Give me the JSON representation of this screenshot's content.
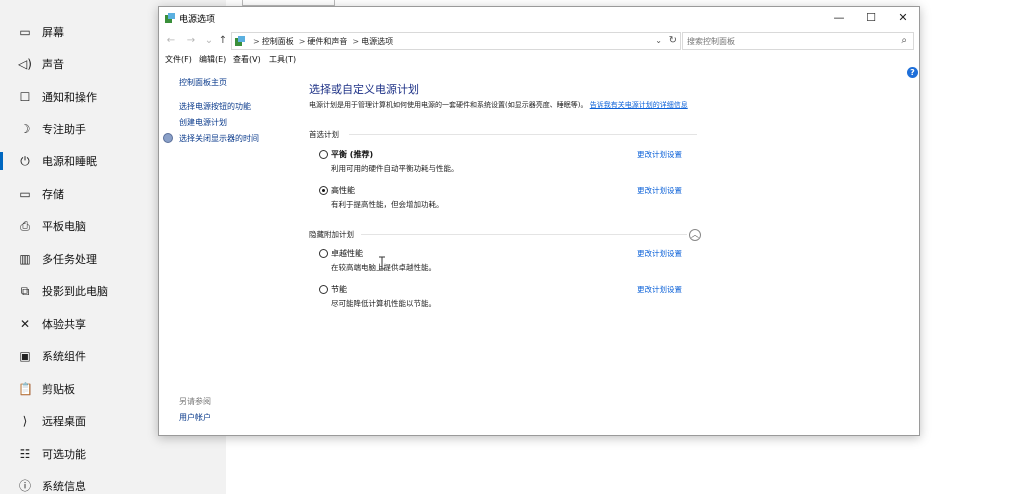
{
  "settings": {
    "items": [
      {
        "icon": "▭",
        "label": "屏幕"
      },
      {
        "icon": "◁)",
        "label": "声音"
      },
      {
        "icon": "☐",
        "label": "通知和操作"
      },
      {
        "icon": "☽",
        "label": "专注助手"
      },
      {
        "icon": "⏻",
        "label": "电源和睡眠"
      },
      {
        "icon": "▭",
        "label": "存储"
      },
      {
        "icon": "⎙",
        "label": "平板电脑"
      },
      {
        "icon": "▥",
        "label": "多任务处理"
      },
      {
        "icon": "⧉",
        "label": "投影到此电脑"
      },
      {
        "icon": "✕",
        "label": "体验共享"
      },
      {
        "icon": "▣",
        "label": "系统组件"
      },
      {
        "icon": "📋",
        "label": "剪贴板"
      },
      {
        "icon": "⟩",
        "label": "远程桌面"
      },
      {
        "icon": "☷",
        "label": "可选功能"
      },
      {
        "icon": "ⓘ",
        "label": "系统信息"
      }
    ]
  },
  "window": {
    "title": "电源选项",
    "controls": {
      "minimize": "—",
      "maximize": "☐",
      "close": "✕"
    }
  },
  "address": {
    "crumbs": [
      "控制面板",
      "硬件和声音",
      "电源选项"
    ],
    "separator": ">"
  },
  "search": {
    "placeholder": "搜索控制面板"
  },
  "menu": [
    "文件(F)",
    "编辑(E)",
    "查看(V)",
    "工具(T)"
  ],
  "left_pane": {
    "home": "控制面板主页",
    "links": [
      "选择电源按钮的功能",
      "创建电源计划",
      "选择关闭显示器的时间"
    ],
    "see_also": "另请参阅",
    "user_accounts": "用户帐户"
  },
  "main": {
    "heading": "选择或自定义电源计划",
    "description": "电源计划是用于管理计算机如何使用电源的一套硬件和系统设置(如显示器亮度、睡眠等)。",
    "description_link": "告诉我有关电源计划的详细信息",
    "preferred_label": "首选计划",
    "hidden_label": "隐藏附加计划",
    "change_link": "更改计划设置",
    "plans": [
      {
        "name": "平衡 (推荐)",
        "desc": "利用可用的硬件自动平衡功耗与性能。",
        "selected": false,
        "bold": true
      },
      {
        "name": "高性能",
        "desc": "有利于提高性能，但会增加功耗。",
        "selected": true,
        "bold": false
      },
      {
        "name": "卓越性能",
        "desc": "在较高端电脑上提供卓越性能。",
        "selected": false,
        "bold": false
      },
      {
        "name": "节能",
        "desc": "尽可能降低计算机性能以节能。",
        "selected": false,
        "bold": false
      }
    ]
  }
}
